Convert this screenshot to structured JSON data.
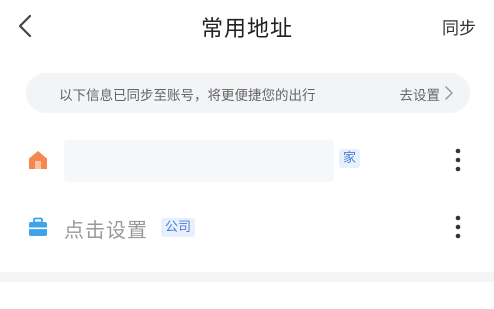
{
  "header": {
    "back_icon": "chevron-left-icon",
    "title": "常用地址",
    "sync_label": "同步"
  },
  "sync_banner": {
    "text": "以下信息已同步至账号，将更便捷您的出行",
    "action_label": "去设置",
    "action_icon": "chevron-right-icon"
  },
  "addresses": [
    {
      "icon": "home-icon",
      "icon_color": "#F5874F",
      "value": "",
      "tag": "家",
      "more_icon": "more-vertical-icon"
    },
    {
      "icon": "briefcase-icon",
      "icon_color": "#3FA3EA",
      "value": "点击设置",
      "tag": "公司",
      "more_icon": "more-vertical-icon"
    }
  ],
  "colors": {
    "tag_text": "#4A7FD6",
    "tag_bg": "#E9F0FD",
    "banner_bg": "#F3F4F6"
  }
}
